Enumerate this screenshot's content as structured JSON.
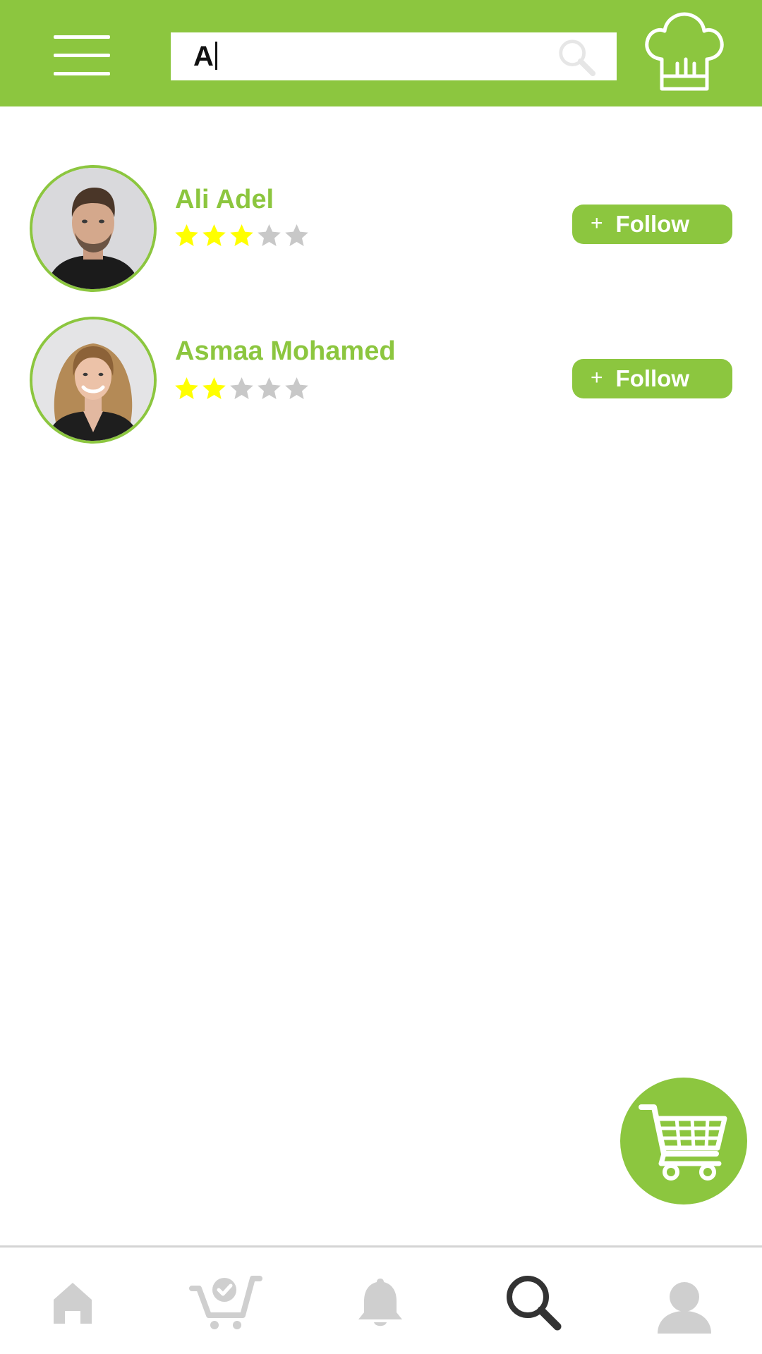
{
  "header": {
    "menu_icon": "hamburger-menu-icon",
    "search_value": "A",
    "search_icon": "search-icon",
    "brand_icon": "chef-hat-icon",
    "background_color": "#8cc63f"
  },
  "results": [
    {
      "name": "Ali Adel",
      "rating": 3,
      "rating_max": 5,
      "follow_label": "Follow",
      "follow_icon": "plus-icon"
    },
    {
      "name": "Asmaa Mohamed",
      "rating": 2,
      "rating_max": 5,
      "follow_label": "Follow",
      "follow_icon": "plus-icon"
    }
  ],
  "fab": {
    "icon": "shopping-cart-icon"
  },
  "bottom_nav": {
    "items": [
      {
        "icon": "home-icon",
        "active": false
      },
      {
        "icon": "cart-check-icon",
        "active": false
      },
      {
        "icon": "bell-icon",
        "active": false
      },
      {
        "icon": "search-icon",
        "active": true
      },
      {
        "icon": "user-icon",
        "active": false
      }
    ]
  },
  "colors": {
    "accent": "#8cc63f",
    "star_filled": "#ffff00",
    "star_empty": "#c8c8c8",
    "nav_inactive": "#cfcfcf",
    "nav_active": "#333333"
  }
}
